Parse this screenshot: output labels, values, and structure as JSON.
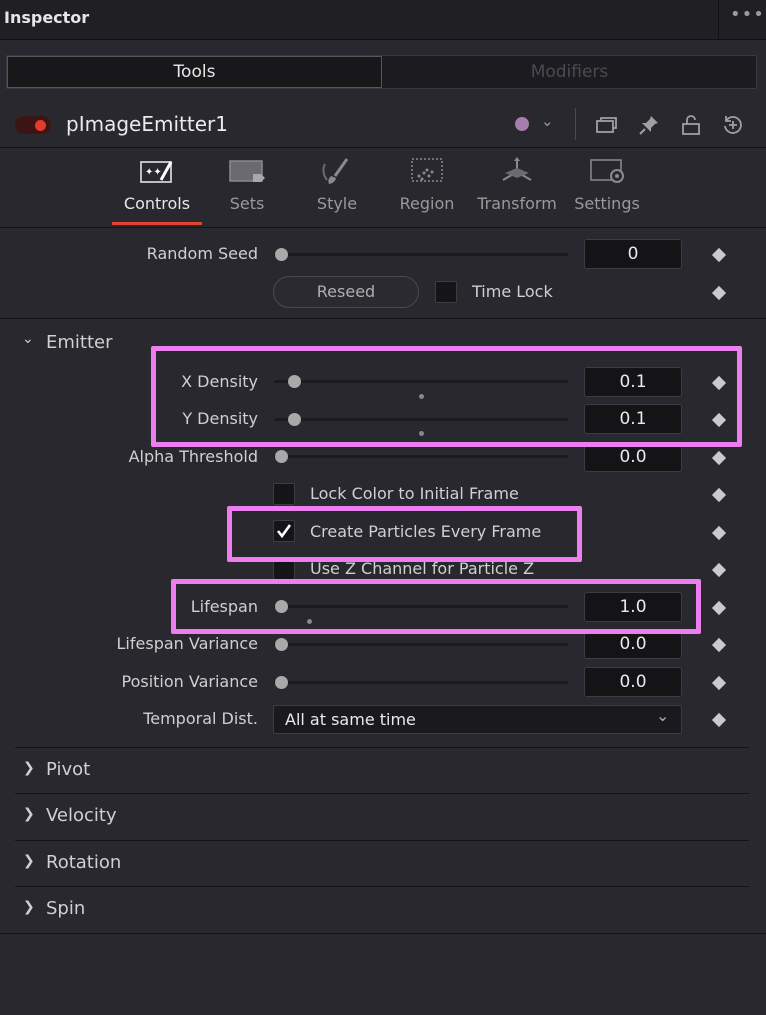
{
  "panel": {
    "title": "Inspector"
  },
  "top_tabs": {
    "tools": "Tools",
    "modifiers": "Modifiers"
  },
  "tool": {
    "name": "pImageEmitter1",
    "enabled": true,
    "color": "#a77eab"
  },
  "category_tabs": [
    "Controls",
    "Sets",
    "Style",
    "Region",
    "Transform",
    "Settings"
  ],
  "active_category": "Controls",
  "random_seed": {
    "label": "Random Seed",
    "value": "0",
    "reseed_label": "Reseed",
    "time_lock_label": "Time Lock"
  },
  "emitter": {
    "section_label": "Emitter",
    "x_density": {
      "label": "X Density",
      "value": "0.1",
      "level": 0.05
    },
    "y_density": {
      "label": "Y Density",
      "value": "0.1",
      "level": 0.05
    },
    "alpha_threshold": {
      "label": "Alpha Threshold",
      "value": "0.0",
      "level": 0
    },
    "lock_color": {
      "label": "Lock Color to Initial Frame",
      "checked": false
    },
    "create_particles": {
      "label": "Create Particles Every Frame",
      "checked": true
    },
    "use_z": {
      "label": "Use Z Channel for Particle Z",
      "checked": false
    },
    "lifespan": {
      "label": "Lifespan",
      "value": "1.0",
      "level": 0
    },
    "lifespan_variance": {
      "label": "Lifespan Variance",
      "value": "0.0",
      "level": 0
    },
    "position_variance": {
      "label": "Position Variance",
      "value": "0.0",
      "level": 0
    },
    "temporal_dist": {
      "label": "Temporal Dist.",
      "value": "All at same time"
    }
  },
  "collapsed_sections": [
    "Pivot",
    "Velocity",
    "Rotation",
    "Spin"
  ],
  "colors": {
    "accent": "#e0442e",
    "highlight": "#ec7ef0"
  }
}
